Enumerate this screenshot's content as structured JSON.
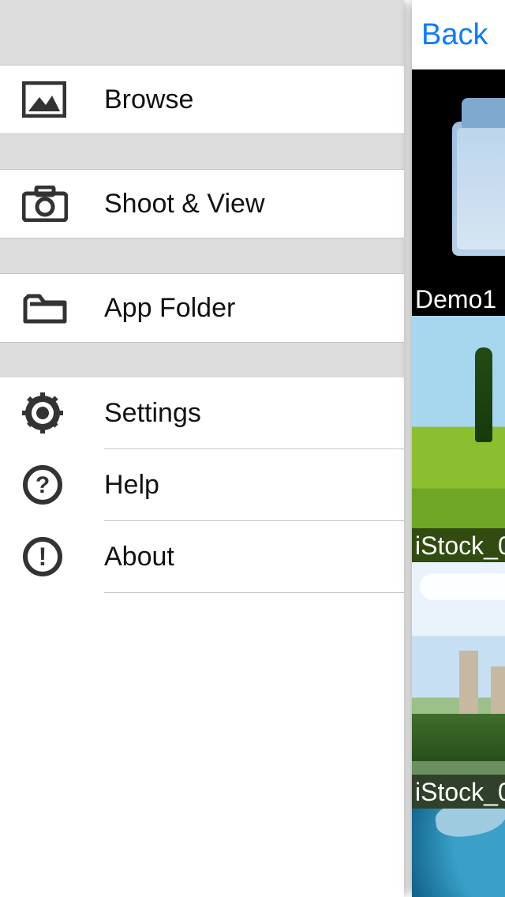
{
  "menu": {
    "browse_label": "Browse",
    "shoot_view_label": "Shoot & View",
    "app_folder_label": "App Folder",
    "settings_label": "Settings",
    "help_label": "Help",
    "about_label": "About"
  },
  "main": {
    "back_label": "Back",
    "tiles": {
      "t0": "Demo1",
      "t1": "iStock_0",
      "t2": "iStock_0"
    }
  }
}
